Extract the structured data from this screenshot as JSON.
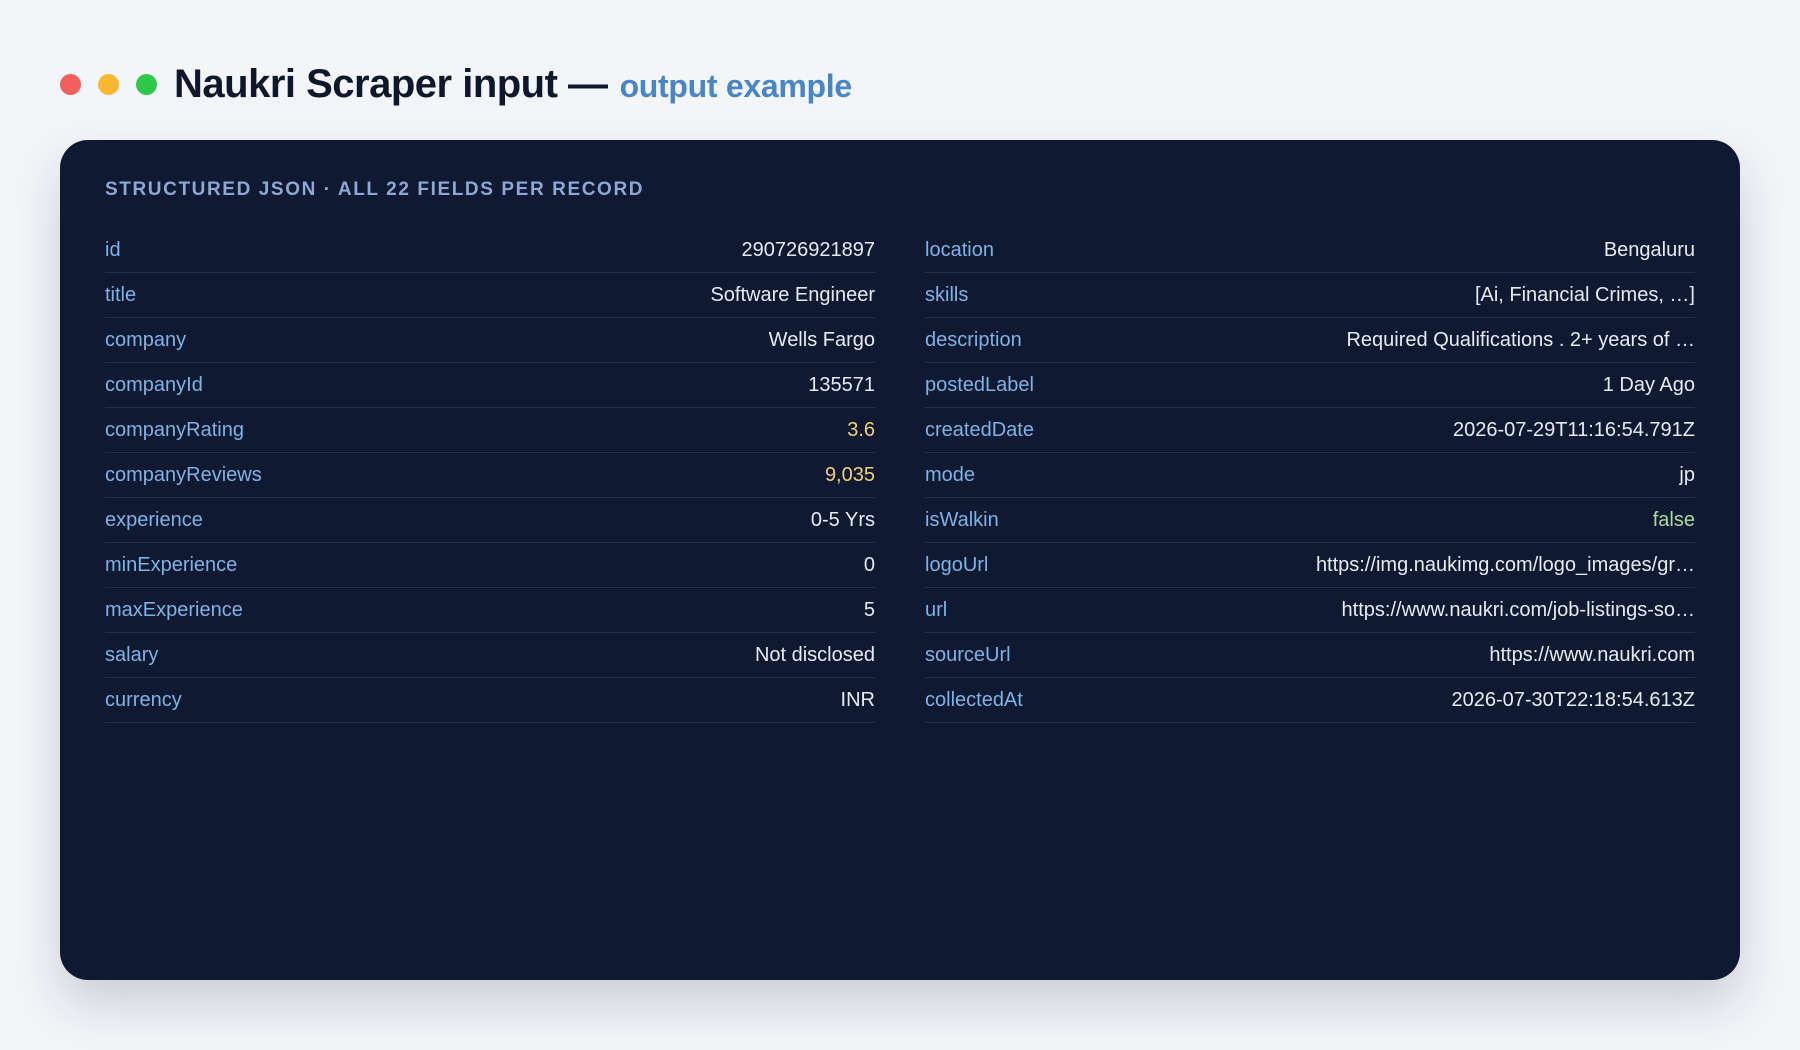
{
  "header": {
    "title": "Naukri Scraper input —",
    "subtitle": "output example",
    "dots": [
      {
        "name": "close-dot",
        "color": "#f25f5c"
      },
      {
        "name": "minimize-dot",
        "color": "#f7b731"
      },
      {
        "name": "maximize-dot",
        "color": "#2ec84a"
      }
    ]
  },
  "card": {
    "section_label": "STRUCTURED JSON · ALL 22 FIELDS PER RECORD",
    "left_fields": [
      {
        "key": "id",
        "value": "290726921897"
      },
      {
        "key": "title",
        "value": "Software Engineer"
      },
      {
        "key": "company",
        "value": "Wells Fargo"
      },
      {
        "key": "companyId",
        "value": "135571"
      },
      {
        "key": "companyRating",
        "value": "3.6",
        "accent": "num"
      },
      {
        "key": "companyReviews",
        "value": "9,035",
        "accent": "num"
      },
      {
        "key": "experience",
        "value": "0-5 Yrs"
      },
      {
        "key": "minExperience",
        "value": "0"
      },
      {
        "key": "maxExperience",
        "value": "5"
      },
      {
        "key": "salary",
        "value": "Not disclosed"
      },
      {
        "key": "currency",
        "value": "INR"
      }
    ],
    "right_fields": [
      {
        "key": "location",
        "value": "Bengaluru"
      },
      {
        "key": "skills",
        "value": "[Ai, Financial Crimes, …]"
      },
      {
        "key": "description",
        "value": "Required Qualifications . 2+ years of …"
      },
      {
        "key": "postedLabel",
        "value": "1 Day Ago"
      },
      {
        "key": "createdDate",
        "value": "2026-07-29T11:16:54.791Z"
      },
      {
        "key": "mode",
        "value": "jp"
      },
      {
        "key": "isWalkin",
        "value": "false",
        "accent": "bool"
      },
      {
        "key": "logoUrl",
        "value": "https://img.naukimg.com/logo_images/gr…"
      },
      {
        "key": "url",
        "value": "https://www.naukri.com/job-listings-so…"
      },
      {
        "key": "sourceUrl",
        "value": "https://www.naukri.com"
      },
      {
        "key": "collectedAt",
        "value": "2026-07-30T22:18:54.613Z"
      }
    ]
  },
  "colors": {
    "card_bg": "#0f1932",
    "key_text": "#7fb2e5",
    "value_text": "#e6ebf3",
    "numeric_accent": "#f2cf7d",
    "boolean_accent": "#a8dca0",
    "subtitle_accent": "#4a86c6"
  }
}
